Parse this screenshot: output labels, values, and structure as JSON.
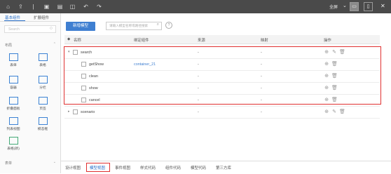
{
  "toolbar": {
    "fullscreen": "全屏",
    "icons": [
      "home-icon",
      "export-icon",
      "divider",
      "save-icon",
      "save-as-icon",
      "preview-icon",
      "undo-icon",
      "redo-icon"
    ]
  },
  "left_panel": {
    "tabs": [
      "基本组件",
      "扩展组件"
    ],
    "search_placeholder": "Search",
    "sections": [
      {
        "title": "布局",
        "items": [
          "表单",
          "表格",
          "容器",
          "分栏",
          "折叠面板",
          "页签",
          "列表视图",
          "模态框",
          "表格(新)"
        ]
      },
      {
        "title": "表单"
      }
    ]
  },
  "main": {
    "new_model_button": "新增模型",
    "search_placeholder": "请输入模型名称或路径搜索",
    "columns": [
      "名称",
      "绑定组件",
      "来源",
      "映射",
      "操作"
    ],
    "rows": [
      {
        "name": "search",
        "component": "",
        "source": "-",
        "mapping": "-",
        "level": 0,
        "expanded": true
      },
      {
        "name": "getShow",
        "component": "container_21",
        "source": "-",
        "mapping": "-",
        "level": 1
      },
      {
        "name": "clean",
        "component": "",
        "source": "-",
        "mapping": "-",
        "level": 1
      },
      {
        "name": "show",
        "component": "",
        "source": "-",
        "mapping": "-",
        "level": 1
      },
      {
        "name": "cancel",
        "component": "",
        "source": "-",
        "mapping": "-",
        "level": 1
      },
      {
        "name": "scenario",
        "component": "",
        "source": "-",
        "mapping": "-",
        "level": 0,
        "expanded": false
      }
    ]
  },
  "bottom_tabs": [
    "设计视图",
    "模型视图",
    "事件视图",
    "样式代码",
    "组件代码",
    "模型代码",
    "第三方库"
  ],
  "active_bottom_tab": "模型视图",
  "colors": {
    "accent": "#3f7fd1",
    "highlight": "#e03030",
    "toolbar": "#4a4a4a"
  }
}
